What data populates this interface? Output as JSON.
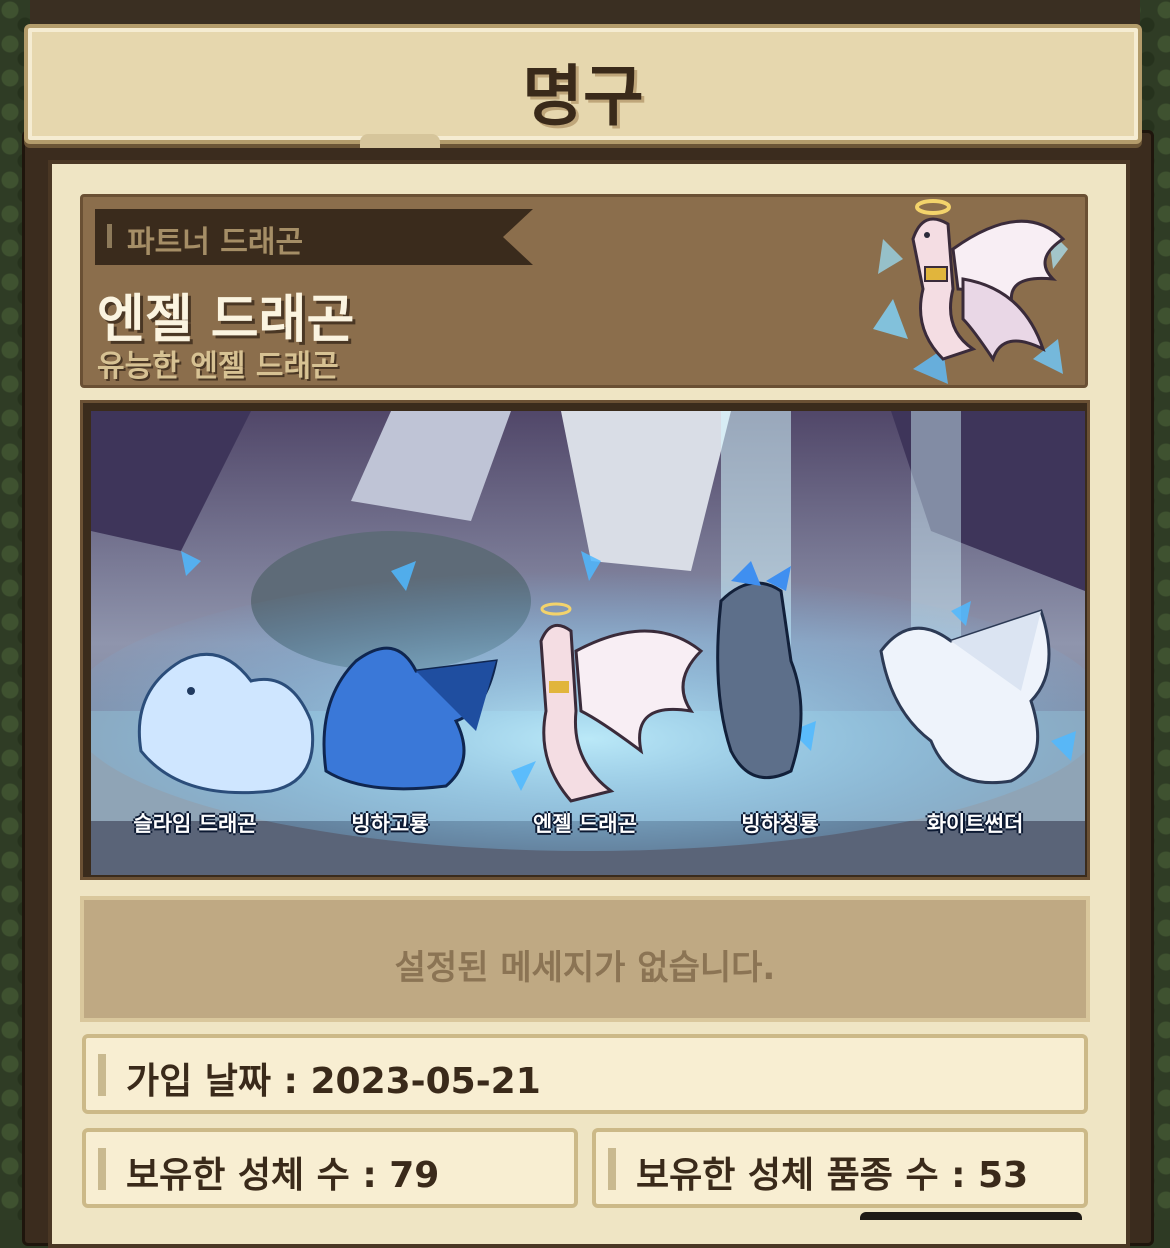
{
  "title": "명구",
  "partner": {
    "tag": "파트너 드래곤",
    "name": "엔젤 드래곤",
    "subtitle": "유능한 엔젤 드래곤"
  },
  "scene": {
    "dragons": [
      {
        "label": "슬라임 드래곤",
        "color": "#cfe6ff"
      },
      {
        "label": "빙하고룡",
        "color": "#3a78d8"
      },
      {
        "label": "엔젤 드래곤",
        "color": "#f2d8e0"
      },
      {
        "label": "빙하청룡",
        "color": "#5d6f8a"
      },
      {
        "label": "화이트썬더",
        "color": "#eef3fb"
      }
    ]
  },
  "message": "설정된 메세지가 없습니다.",
  "info": {
    "join_date": "가입 날짜 : 2023-05-21",
    "owned_count": "보유한 성체 수 : 79",
    "owned_species": "보유한 성체 품종 수 : 53"
  },
  "colors": {
    "panel": "#efe5c4",
    "frame": "#3b2c1e",
    "accent_card": "#8b6e4c"
  }
}
